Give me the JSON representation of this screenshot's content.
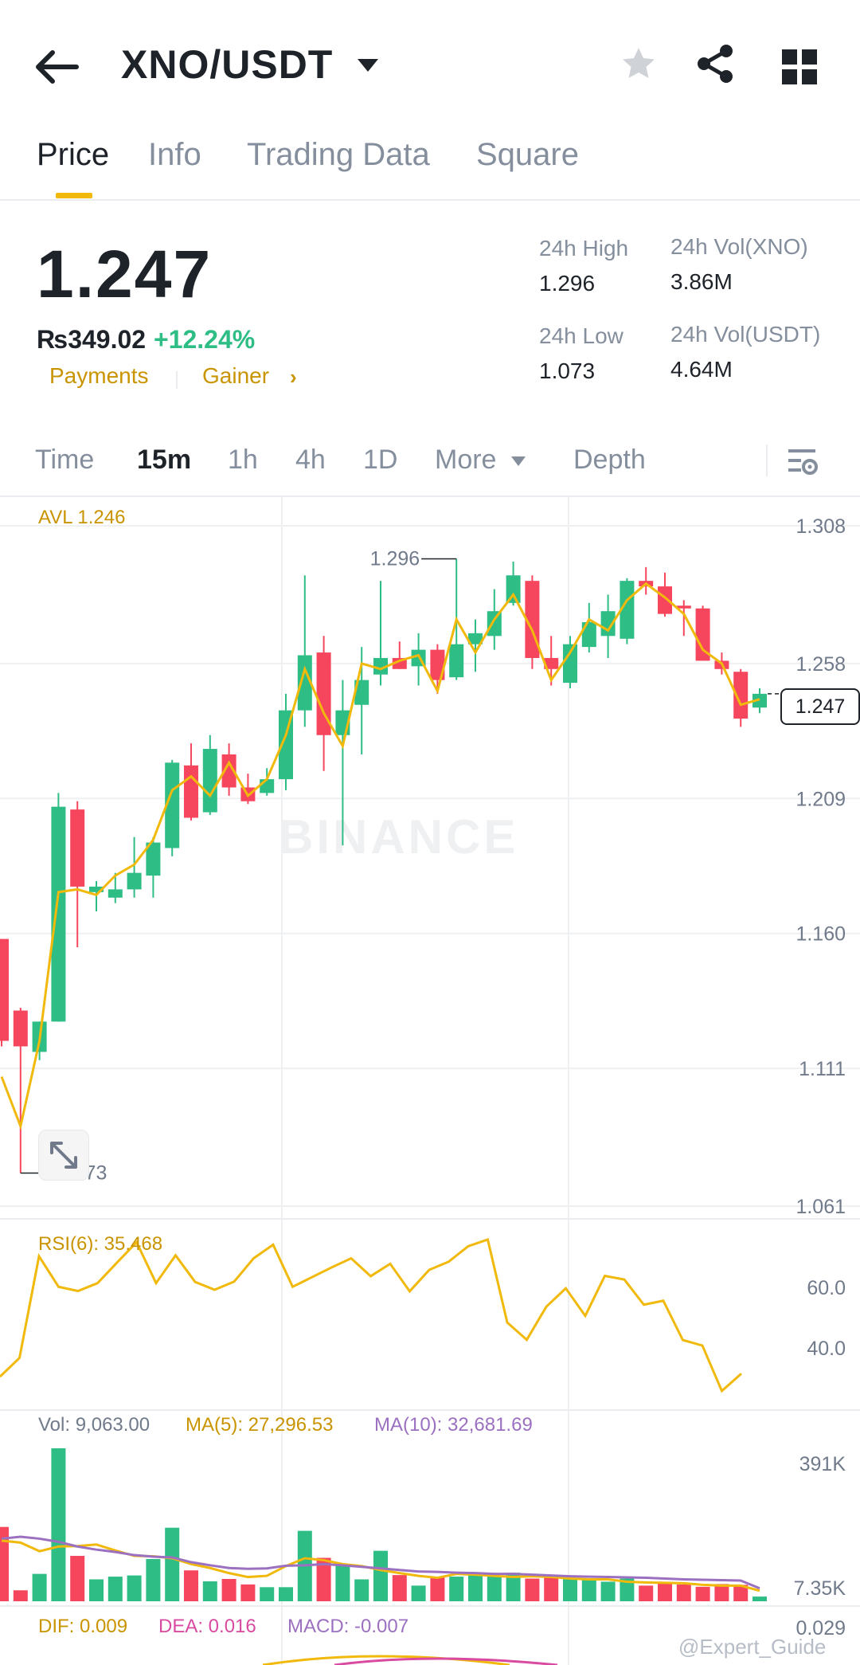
{
  "header": {
    "pair": "XNO/USDT"
  },
  "tabs": [
    "Price",
    "Info",
    "Trading Data",
    "Square"
  ],
  "price": {
    "last": "1.247",
    "fiat": "₨349.02",
    "change": "+12.24%",
    "tags": [
      "Payments",
      "Gainer"
    ],
    "stats": {
      "high_label": "24h High",
      "high_value": "1.296",
      "low_label": "24h Low",
      "low_value": "1.073",
      "vol_base_label": "24h Vol(XNO)",
      "vol_base_value": "3.86M",
      "vol_quote_label": "24h Vol(USDT)",
      "vol_quote_value": "4.64M"
    }
  },
  "intervals": [
    "Time",
    "15m",
    "1h",
    "4h",
    "1D",
    "More",
    "Depth"
  ],
  "active_interval": "15m",
  "colors": {
    "up": "#2ebd85",
    "down": "#f6465d",
    "accent": "#f0b90b",
    "ma": "#f0b90b",
    "ma10": "#9c70c0"
  },
  "watermark": "BINANCE",
  "credit": "@Expert_Guide",
  "chart_data": {
    "type": "candlestick",
    "avl_label": "AVL 1.246",
    "y_ticks": [
      "1.308",
      "1.258",
      "1.209",
      "1.160",
      "1.111",
      "1.061"
    ],
    "ylim": [
      1.061,
      1.308
    ],
    "high_marker": "1.296",
    "low_marker": "1.073",
    "last_price_tag": "1.247",
    "candles": [
      [
        1.158,
        1.158,
        1.119,
        1.121
      ],
      [
        1.132,
        1.133,
        1.073,
        1.119
      ],
      [
        1.117,
        1.128,
        1.114,
        1.128
      ],
      [
        1.128,
        1.211,
        1.128,
        1.206
      ],
      [
        1.205,
        1.208,
        1.155,
        1.177
      ],
      [
        1.175,
        1.179,
        1.168,
        1.177
      ],
      [
        1.173,
        1.182,
        1.171,
        1.176
      ],
      [
        1.176,
        1.195,
        1.173,
        1.182
      ],
      [
        1.181,
        1.195,
        1.173,
        1.193
      ],
      [
        1.191,
        1.223,
        1.188,
        1.222
      ],
      [
        1.221,
        1.229,
        1.201,
        1.202
      ],
      [
        1.204,
        1.232,
        1.203,
        1.227
      ],
      [
        1.225,
        1.229,
        1.21,
        1.213
      ],
      [
        1.213,
        1.218,
        1.207,
        1.208
      ],
      [
        1.211,
        1.22,
        1.21,
        1.216
      ],
      [
        1.216,
        1.247,
        1.212,
        1.241
      ],
      [
        1.241,
        1.29,
        1.235,
        1.261
      ],
      [
        1.262,
        1.268,
        1.219,
        1.232
      ],
      [
        1.232,
        1.252,
        1.192,
        1.241
      ],
      [
        1.243,
        1.264,
        1.225,
        1.252
      ],
      [
        1.254,
        1.288,
        1.25,
        1.26
      ],
      [
        1.26,
        1.266,
        1.256,
        1.256
      ],
      [
        1.257,
        1.269,
        1.25,
        1.263
      ],
      [
        1.263,
        1.265,
        1.247,
        1.252
      ],
      [
        1.253,
        1.296,
        1.252,
        1.265
      ],
      [
        1.265,
        1.274,
        1.255,
        1.269
      ],
      [
        1.268,
        1.285,
        1.263,
        1.277
      ],
      [
        1.28,
        1.295,
        1.279,
        1.29
      ],
      [
        1.288,
        1.29,
        1.256,
        1.26
      ],
      [
        1.26,
        1.268,
        1.25,
        1.256
      ],
      [
        1.251,
        1.268,
        1.249,
        1.265
      ],
      [
        1.264,
        1.28,
        1.262,
        1.273
      ],
      [
        1.268,
        1.283,
        1.26,
        1.277
      ],
      [
        1.267,
        1.289,
        1.265,
        1.288
      ],
      [
        1.288,
        1.293,
        1.283,
        1.286
      ],
      [
        1.286,
        1.291,
        1.275,
        1.276
      ],
      [
        1.279,
        1.281,
        1.268,
        1.278
      ],
      [
        1.278,
        1.279,
        1.259,
        1.259
      ],
      [
        1.259,
        1.262,
        1.254,
        1.256
      ],
      [
        1.255,
        1.256,
        1.235,
        1.238
      ],
      [
        1.242,
        1.249,
        1.24,
        1.247
      ]
    ],
    "ma_line": [
      1.108,
      1.09,
      1.121,
      1.175,
      1.176,
      1.174,
      1.181,
      1.185,
      1.194,
      1.212,
      1.217,
      1.21,
      1.222,
      1.21,
      1.216,
      1.232,
      1.256,
      1.24,
      1.228,
      1.258,
      1.256,
      1.259,
      1.261,
      1.248,
      1.274,
      1.262,
      1.274,
      1.283,
      1.27,
      1.252,
      1.262,
      1.274,
      1.27,
      1.281,
      1.287,
      1.282,
      1.276,
      1.263,
      1.258,
      1.243,
      1.245
    ],
    "rsi": {
      "label": "RSI(6): 35.468",
      "ticks": [
        "60.0",
        "40.0"
      ],
      "values": [
        30.5,
        36.7,
        70.3,
        60.2,
        58.8,
        61.4,
        68.2,
        74.9,
        61.4,
        70.6,
        61.8,
        59.2,
        61.9,
        69.6,
        74.1,
        60.2,
        63.4,
        66.6,
        69.6,
        63.7,
        67.8,
        58.7,
        65.8,
        68.5,
        73.6,
        75.8,
        48.4,
        42.7,
        53.6,
        59.7,
        50.6,
        63.8,
        62.6,
        54.3,
        55.6,
        42.6,
        40.8,
        25.8,
        31.5
      ]
    },
    "volume": {
      "label": "Vol: 9,063.00",
      "ma5_label": "MA(5): 27,296.53",
      "ma10_label": "MA(10): 32,681.69",
      "ticks": [
        "391K",
        "7.35K"
      ],
      "values": [
        190,
        28,
        70,
        391,
        116,
        56,
        63,
        66,
        108,
        188,
        79,
        51,
        57,
        43,
        36,
        36,
        180,
        111,
        93,
        56,
        129,
        67,
        40,
        63,
        63,
        74,
        63,
        73,
        58,
        60,
        58,
        58,
        50,
        58,
        40,
        46,
        43,
        37,
        44,
        42,
        12
      ],
      "ma5": [
        155,
        150,
        128,
        140,
        141,
        145,
        130,
        116,
        115,
        110,
        95,
        85,
        72,
        62,
        65,
        90,
        110,
        105,
        95,
        90,
        80,
        72,
        65,
        60,
        70,
        68,
        65,
        62,
        64,
        62,
        58,
        56,
        56,
        50,
        48,
        47,
        46,
        42,
        40,
        40,
        27
      ],
      "ma10": [
        160,
        165,
        160,
        152,
        140,
        132,
        126,
        118,
        114,
        112,
        100,
        92,
        85,
        83,
        84,
        91,
        92,
        95,
        92,
        88,
        84,
        80,
        76,
        75,
        73,
        72,
        70,
        70,
        68,
        66,
        64,
        63,
        62,
        61,
        60,
        58,
        56,
        55,
        54,
        53,
        33
      ]
    },
    "macd": {
      "dif_label": "DIF: 0.009",
      "dea_label": "DEA: 0.016",
      "macd_label": "MACD: -0.007",
      "tick": "0.029"
    }
  }
}
